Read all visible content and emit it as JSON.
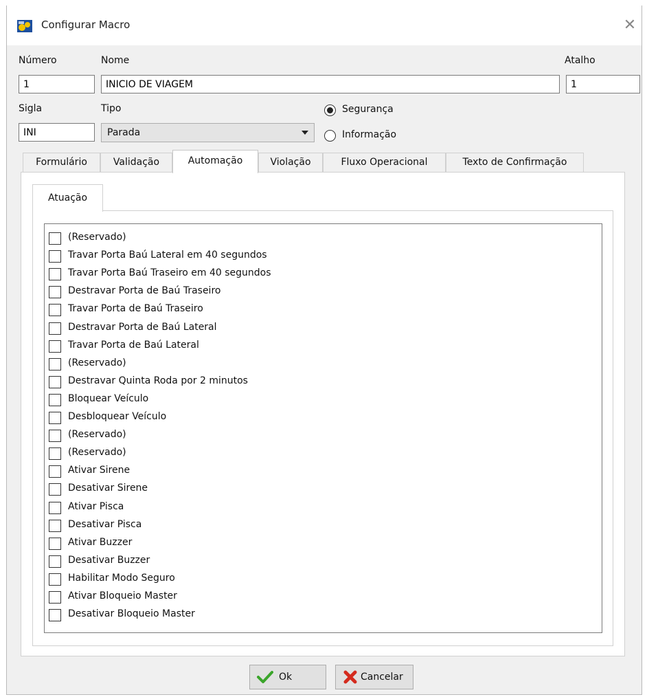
{
  "window": {
    "title": "Configurar Macro"
  },
  "fields": {
    "numero_label": "Número",
    "numero_value": "1",
    "nome_label": "Nome",
    "nome_value": "INICIO DE VIAGEM",
    "atalho_label": "Atalho",
    "atalho_value": "1",
    "sigla_label": "Sigla",
    "sigla_value": "INI",
    "tipo_label": "Tipo",
    "tipo_value": "Parada"
  },
  "radios": [
    {
      "label": "Segurança",
      "selected": true
    },
    {
      "label": "Informação",
      "selected": false
    }
  ],
  "tabs": [
    "Formulário",
    "Validação",
    "Automação",
    "Violação",
    "Fluxo Operacional",
    "Texto de Confirmação"
  ],
  "active_tab": "Automação",
  "subtab": "Atuação",
  "items": [
    "(Reservado)",
    "Travar Porta Baú Lateral em 40 segundos",
    "Travar Porta Baú Traseiro em 40 segundos",
    "Destravar Porta de Baú Traseiro",
    "Travar Porta de Baú Traseiro",
    "Destravar Porta de Baú Lateral",
    "Travar Porta de Baú Lateral",
    "(Reservado)",
    "Destravar Quinta Roda por 2 minutos",
    "Bloquear Veículo",
    "Desbloquear Veículo",
    "(Reservado)",
    "(Reservado)",
    "Ativar Sirene",
    "Desativar Sirene",
    "Ativar Pisca",
    "Desativar Pisca",
    "Ativar Buzzer",
    "Desativar Buzzer",
    "Habilitar Modo Seguro",
    "Ativar Bloqueio Master",
    "Desativar Bloqueio Master"
  ],
  "buttons": {
    "ok": "Ok",
    "cancel": "Cancelar"
  },
  "icons": {
    "ok": "checkmark-icon",
    "cancel": "red-x-icon"
  },
  "colors": {
    "ok_icon": "#3aa52a",
    "cancel_icon": "#d42b1e",
    "window_bg": "#f0f0f0"
  }
}
